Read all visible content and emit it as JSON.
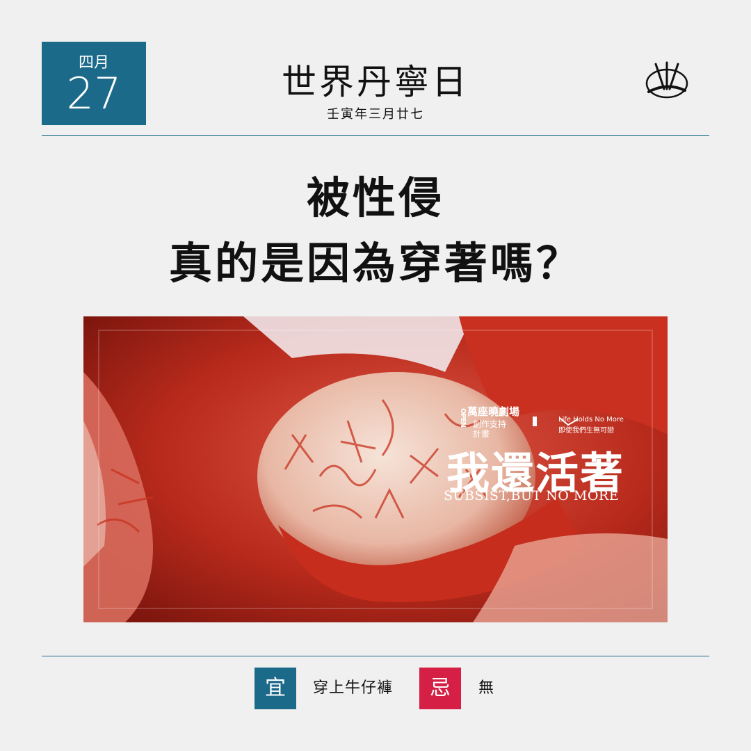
{
  "date": {
    "month": "四月",
    "day": "27"
  },
  "header": {
    "title": "世界丹寧日",
    "subtitle": "壬寅年三月廿七"
  },
  "logo": {
    "icon": "brush-logo-icon"
  },
  "headline": {
    "line1": "被性侵",
    "line2": "真的是因為穿著嗎？"
  },
  "poster": {
    "credit_open": "OPEN",
    "credit_venue": "萬座曉劇場",
    "credit_support": "創作支持",
    "credit_plan": "計畫",
    "credit_en": "Life Holds No More",
    "credit_zh": "即使我們生無可戀",
    "title": "我還活著",
    "subtitle": "SUBSIST,BUT NO MORE"
  },
  "footer": {
    "do_label": "宜",
    "do_text": "穿上牛仔褲",
    "dont_label": "忌",
    "dont_text": "無"
  },
  "colors": {
    "accent": "#1c6a8a",
    "warn": "#d51f45",
    "background": "#f0f0f0"
  }
}
